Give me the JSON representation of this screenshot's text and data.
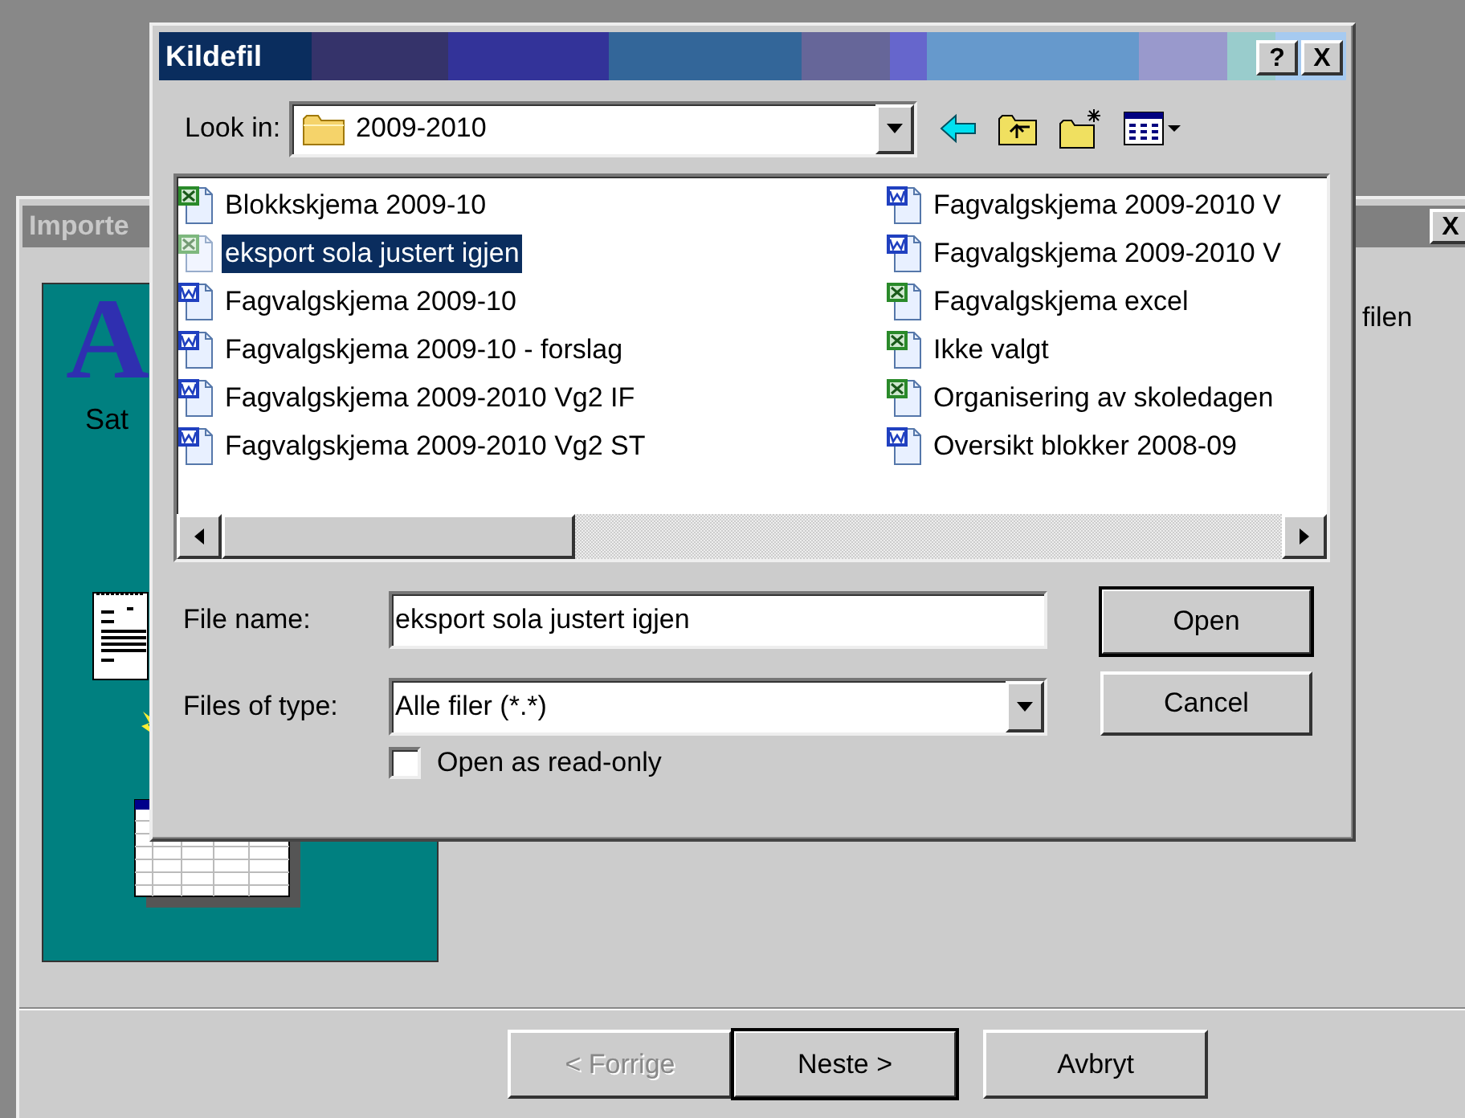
{
  "background_window": {
    "title": "Importe",
    "close_label": "X",
    "logo_letter": "A",
    "caption": "Sat",
    "text": "filen",
    "buttons": [
      {
        "label": "< Forrige",
        "disabled": true,
        "default": false
      },
      {
        "label": "Neste >",
        "disabled": false,
        "default": true
      },
      {
        "label": "Avbryt",
        "disabled": false,
        "default": false
      }
    ]
  },
  "dialog": {
    "title": "Kildefil",
    "help_label": "?",
    "close_label": "X",
    "look_in": {
      "label": "Look in:",
      "value": "2009-2010"
    },
    "files": [
      {
        "name": "Blokkskjema 2009-10",
        "kind": "excel",
        "selected": false
      },
      {
        "name": "eksport sola justert igjen",
        "kind": "excel",
        "selected": true
      },
      {
        "name": "Fagvalgskjema 2009-10",
        "kind": "word",
        "selected": false
      },
      {
        "name": "Fagvalgskjema 2009-10 - forslag",
        "kind": "word",
        "selected": false
      },
      {
        "name": "Fagvalgskjema 2009-2010 Vg2 IF",
        "kind": "word",
        "selected": false
      },
      {
        "name": "Fagvalgskjema 2009-2010 Vg2 ST",
        "kind": "word",
        "selected": false
      },
      {
        "name": "Fagvalgskjema 2009-2010 V",
        "kind": "word",
        "selected": false
      },
      {
        "name": "Fagvalgskjema 2009-2010 V",
        "kind": "word",
        "selected": false
      },
      {
        "name": "Fagvalgskjema excel",
        "kind": "excel",
        "selected": false
      },
      {
        "name": "Ikke valgt",
        "kind": "excel",
        "selected": false
      },
      {
        "name": "Organisering av skoledagen",
        "kind": "excel",
        "selected": false
      },
      {
        "name": "Oversikt blokker 2008-09",
        "kind": "word",
        "selected": false
      }
    ],
    "file_name": {
      "label": "File name:",
      "value": "eksport sola justert igjen"
    },
    "file_type": {
      "label": "Files of type:",
      "value": "Alle filer (*.*)"
    },
    "read_only": {
      "label": "Open as read-only",
      "checked": false
    },
    "buttons": [
      {
        "label": "Open",
        "default": true
      },
      {
        "label": "Cancel",
        "default": false
      }
    ]
  }
}
